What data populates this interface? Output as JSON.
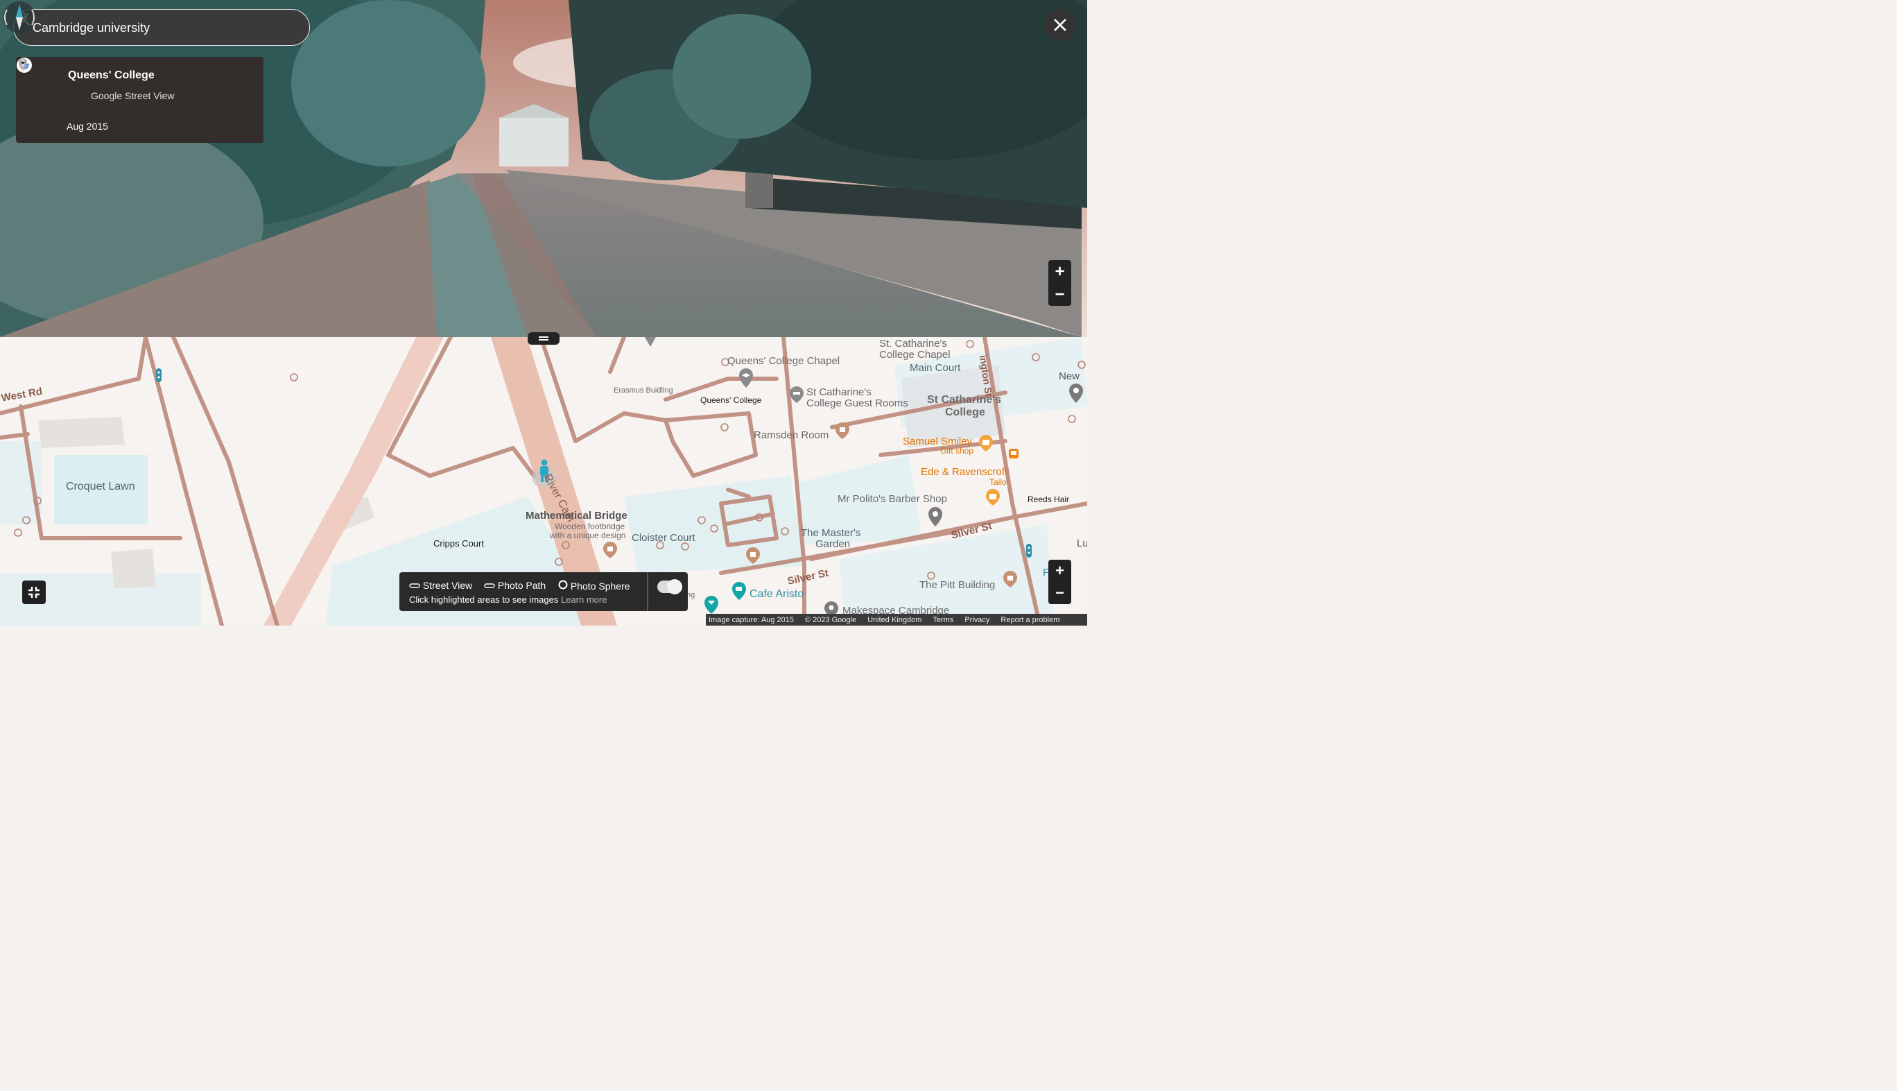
{
  "search": {
    "value": "Cambridge university"
  },
  "place_card": {
    "title": "Queens' College",
    "source": "Google Street View",
    "date": "Aug 2015"
  },
  "legend": {
    "street_view": "Street View",
    "photo_path": "Photo Path",
    "photo_sphere": "Photo Sphere",
    "hint": "Click highlighted areas to see images",
    "learn_more": "Learn more"
  },
  "map_labels": {
    "west_rd": "West Rd",
    "croquet_lawn": "Croquet Lawn",
    "river_cam": "River Cam",
    "mathematical_bridge": "Mathematical Bridge",
    "math_bridge_desc1": "Wooden footbridge",
    "math_bridge_desc2": "with a unique design",
    "cripps_court": "Cripps Court",
    "cloister_court": "Cloister Court",
    "erasmus_building": "Erasmus Buidling",
    "queens_college": "Queens' College",
    "queens_college_chapel": "Queens' College Chapel",
    "st_catharines_chapel_1": "St. Catharine's",
    "st_catharines_chapel_2": "College Chapel",
    "main_court": "Main Court",
    "st_catharines_guest_1": "St Catharine's",
    "st_catharines_guest_2": "College Guest Rooms",
    "st_catharines_college_1": "St Catharine's",
    "st_catharines_college_2": "College",
    "ramsden_room": "Ramsden Room",
    "samuel_smiley": "Samuel Smiley",
    "gift_shop": "Gift shop",
    "ede_ravenscroft": "Ede & Ravenscroft",
    "tailor": "Tailor",
    "mr_polito": "Mr Polito's Barber Shop",
    "reeds_hair": "Reeds Hair",
    "silver_st": "Silver St",
    "masters_garden_1": "The Master's",
    "masters_garden_2": "Garden",
    "pitt_building": "The Pitt Building",
    "cafe_aristo": "Cafe Aristo",
    "makespace": "Makespace Cambridge",
    "new": "New",
    "ington_st": "ington St",
    "fi_lies": "Fi lies",
    "lu": "Lu",
    "ng": "ng"
  },
  "footer": {
    "capture": "Image capture: Aug 2015",
    "copyright": "© 2023 Google",
    "country": "United Kingdom",
    "terms": "Terms",
    "privacy": "Privacy",
    "report": "Report a problem"
  },
  "icons": [
    "search-icon",
    "close-icon",
    "back-arrow-icon",
    "map-pin-icon",
    "more-vert-icon",
    "google-logo",
    "compass-icon",
    "zoom-in-icon",
    "zoom-out-icon",
    "collapse-icon",
    "pegman-icon"
  ],
  "colors": {
    "road": "#e9bfb0",
    "road_outline": "#b98273",
    "water": "#d7ecef",
    "panel": "#332e2b",
    "poi_teal": "#2d8ea5",
    "poi_orange": "#e37400"
  }
}
